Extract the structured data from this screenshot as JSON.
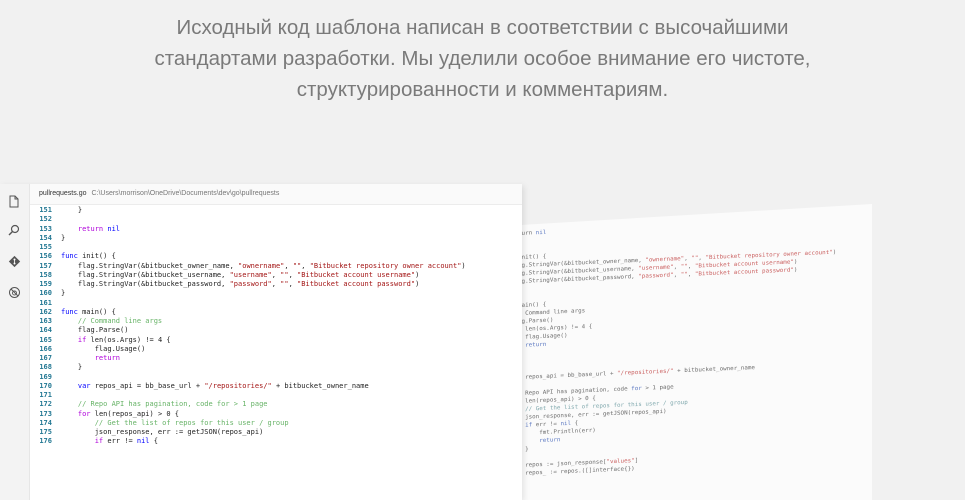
{
  "headline": {
    "line1": "Исходный код шаблона написан в соответствии с высочайшими",
    "line2": "стандартами разработки. Мы уделили особое внимание его чистоте,",
    "line3": "структурированности и комментариям."
  },
  "editor": {
    "filename": "pullrequests.go",
    "path": "C:\\Users\\morrison\\OneDrive\\Documents\\dev\\go\\pullrequests",
    "activity_icons": [
      "files-icon",
      "search-icon",
      "git-icon",
      "debug-icon"
    ],
    "lines": [
      {
        "n": "151",
        "t": "    }"
      },
      {
        "n": "152",
        "t": ""
      },
      {
        "n": "153",
        "t": "    return nil"
      },
      {
        "n": "154",
        "t": "}"
      },
      {
        "n": "155",
        "t": ""
      },
      {
        "n": "156",
        "t": "func init() {"
      },
      {
        "n": "157",
        "t": "    flag.StringVar(&bitbucket_owner_name, \"ownername\", \"\", \"Bitbucket repository owner account\")"
      },
      {
        "n": "158",
        "t": "    flag.StringVar(&bitbucket_username, \"username\", \"\", \"Bitbucket account username\")"
      },
      {
        "n": "159",
        "t": "    flag.StringVar(&bitbucket_password, \"password\", \"\", \"Bitbucket account password\")"
      },
      {
        "n": "160",
        "t": "}"
      },
      {
        "n": "161",
        "t": ""
      },
      {
        "n": "162",
        "t": "func main() {"
      },
      {
        "n": "163",
        "t": "    // Command line args"
      },
      {
        "n": "164",
        "t": "    flag.Parse()"
      },
      {
        "n": "165",
        "t": "    if len(os.Args) != 4 {"
      },
      {
        "n": "166",
        "t": "        flag.Usage()"
      },
      {
        "n": "167",
        "t": "        return"
      },
      {
        "n": "168",
        "t": "    }"
      },
      {
        "n": "169",
        "t": ""
      },
      {
        "n": "170",
        "t": "    var repos_api = bb_base_url + \"/repositories/\" + bitbucket_owner_name"
      },
      {
        "n": "171",
        "t": ""
      },
      {
        "n": "172",
        "t": "    // Repo API has pagination, code for > 1 page"
      },
      {
        "n": "173",
        "t": "    for len(repos_api) > 0 {"
      },
      {
        "n": "174",
        "t": "        // Get the list of repos for this user / group"
      },
      {
        "n": "175",
        "t": "        json_response, err := getJSON(repos_api)"
      },
      {
        "n": "176",
        "t": "        if err != nil {"
      }
    ]
  },
  "back_editor": {
    "lines": [
      "turn nil",
      "",
      "",
      "init() {",
      "ag.StringVar(&bitbucket_owner_name, \"ownername\", \"\", \"Bitbucket repository owner account\")",
      "ag.StringVar(&bitbucket_username, \"username\", \"\", \"Bitbucket account username\")",
      "ag.StringVar(&bitbucket_password, \"password\", \"\", \"Bitbucket account password\")",
      "",
      "",
      "main() {",
      "  Command line args",
      "ag.Parse()",
      "  len(os.Args) != 4 {",
      "  flag.Usage()",
      "  return",
      "",
      "",
      "",
      "r repos_api = bb_base_url + \"/repositories/\" + bitbucket_owner_name",
      "",
      "  Repo API has pagination, code for > 1 page",
      "r len(repos_api) > 0 {",
      "  // Get the list of repos for this user / group",
      "  json_response, err := getJSON(repos_api)",
      "  if err != nil {",
      "      fmt.Println(err)",
      "      return",
      "  }",
      "",
      "  repos := json_response[\"values\"]",
      "  repos_ := repos.([]interface{})"
    ]
  }
}
